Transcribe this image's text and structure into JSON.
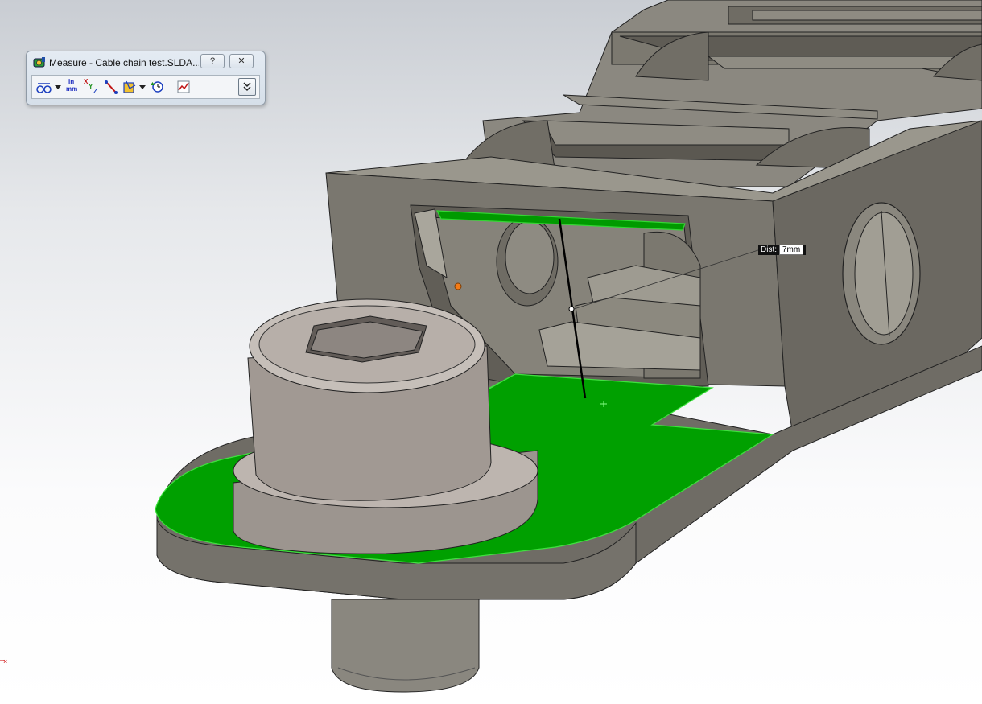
{
  "measure_window": {
    "title": "Measure - Cable chain test.SLDA...",
    "help_label": "?",
    "close_label": "✕",
    "toolbar": {
      "arc_circle_icon": "arc-circle-measurement-icon",
      "units_label_top": "in",
      "units_label_bottom": "mm",
      "xyz_label_x": "X",
      "xyz_label_y": "Y",
      "xyz_label_z": "Z",
      "point_to_point_icon": "point-to-point-icon",
      "projection_icon": "projection-icon",
      "history_icon": "measurement-history-icon",
      "sensor_icon": "create-sensor-icon",
      "expand_icon": "expand-chevron-icon"
    }
  },
  "dimension": {
    "label": "Dist:",
    "value": "7mm"
  },
  "colors": {
    "selection_green": "#00a000",
    "model_gray": "#7d7a73",
    "dimension_tag_bg": "#111111"
  }
}
